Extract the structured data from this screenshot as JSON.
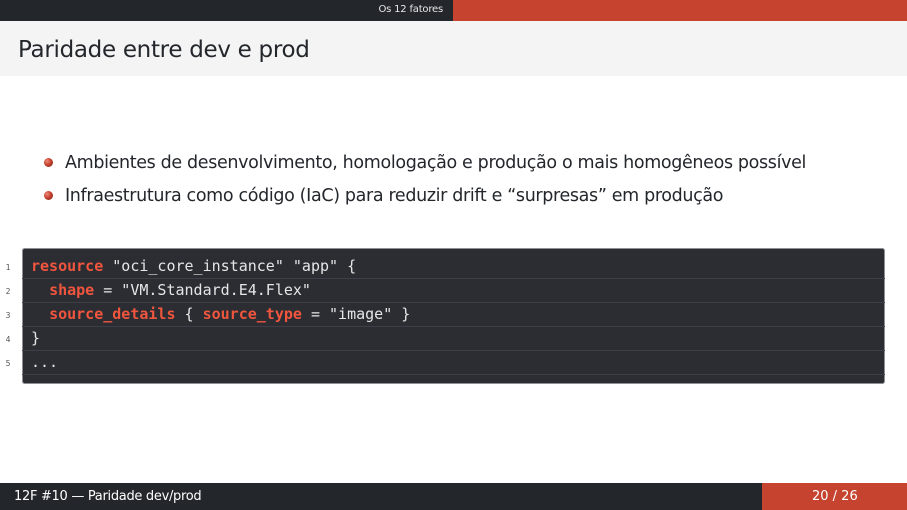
{
  "nav": {
    "section": "Os 12 fatores"
  },
  "frame": {
    "title": "Paridade entre dev e prod"
  },
  "bullets": [
    "Ambientes de desenvolvimento, homologação e produção o mais homogêneos possível",
    "Infraestrutura como código (IaC) para reduzir drift e “surpresas” em produção"
  ],
  "code": {
    "line_numbers": [
      "1",
      "2",
      "3",
      "4",
      "5"
    ],
    "lines": [
      [
        {
          "t": "resource",
          "k": true
        },
        {
          "t": " \"oci_core_instance\" \"app\" {",
          "k": false
        }
      ],
      [
        {
          "t": "  ",
          "k": false
        },
        {
          "t": "shape",
          "k": true
        },
        {
          "t": " = \"VM.Standard.E4.Flex\"",
          "k": false
        }
      ],
      [
        {
          "t": "  ",
          "k": false
        },
        {
          "t": "source_details",
          "k": true
        },
        {
          "t": " { ",
          "k": false
        },
        {
          "t": "source_type",
          "k": true
        },
        {
          "t": " = \"image\" }",
          "k": false
        }
      ],
      [
        {
          "t": "}",
          "k": false
        }
      ],
      [
        {
          "t": "...",
          "k": false
        }
      ]
    ]
  },
  "footer": {
    "title": "12F #10 — Paridade dev/prod",
    "page": "20 / 26"
  },
  "colors": {
    "accent": "#c5432f",
    "dark": "#23262b",
    "keyword": "#f0553d",
    "code_bg": "#2b2d33"
  }
}
